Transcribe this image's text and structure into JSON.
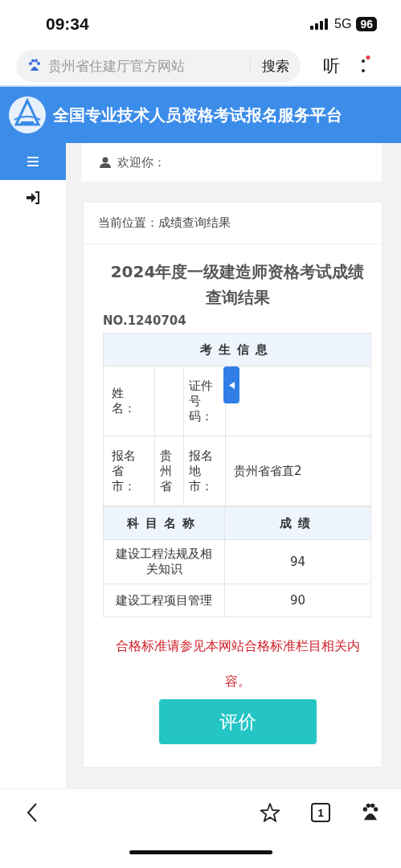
{
  "status_bar": {
    "time": "09:34",
    "network": "5G",
    "battery": "96"
  },
  "address_bar": {
    "query": "贵州省住建厅官方网站",
    "search_button": "搜索",
    "listen_button": "听"
  },
  "site_header": {
    "title": "全国专业技术人员资格考试报名服务平台"
  },
  "welcome": {
    "label": "欢迎你："
  },
  "breadcrumb": "当前位置：成绩查询结果",
  "result": {
    "title": "2024年度一级建造师资格考试成绩查询结果",
    "number": "NO.1240704",
    "info_heading": "考生信息",
    "info_rows": [
      {
        "label_1": "姓名：",
        "label_2": "证件号码："
      },
      {
        "label_1": "报名省市：",
        "value_1": "贵州省",
        "label_2": "报名地市：",
        "value_2": "贵州省省直2"
      }
    ],
    "score_columns": [
      "科目名称",
      "成绩"
    ],
    "scores": [
      {
        "subject": "建设工程法规及相关知识",
        "score": "94"
      },
      {
        "subject": "建设工程项目管理",
        "score": "90"
      }
    ],
    "notice": "合格标准请参见本网站合格标准栏目相关内容。",
    "rate_button": "评价"
  },
  "bottom_bar": {
    "tabs_count": "1"
  }
}
